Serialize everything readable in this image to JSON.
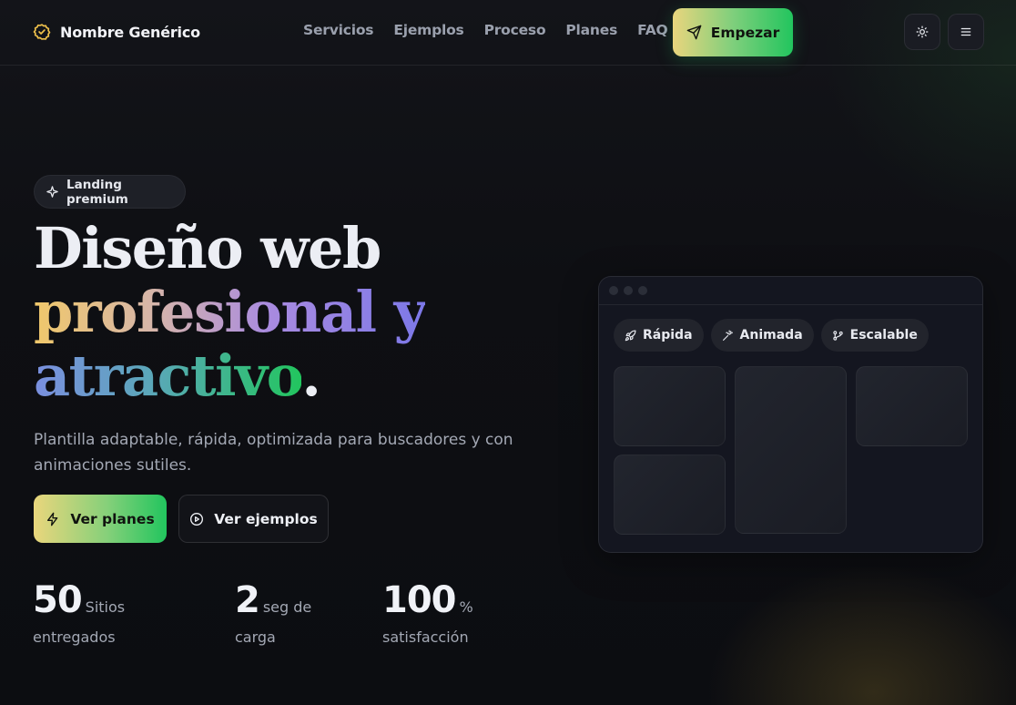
{
  "header": {
    "brand_name": "Nombre Genérico",
    "brand_icon": "badge-check-icon",
    "nav": [
      "Servicios",
      "Ejemplos",
      "Proceso",
      "Planes",
      "FAQ"
    ],
    "cta_label": "Empezar",
    "cta_icon": "send-icon",
    "theme_icon": "sun-icon",
    "menu_icon": "menu-icon"
  },
  "hero": {
    "badge_label": "Landing premium",
    "badge_icon": "sparkle-icon",
    "headline_line1": "Diseño web",
    "headline_grad1": "profesional y",
    "headline_grad2": "atractivo",
    "headline_dot": ".",
    "subtitle": "Plantilla adaptable, rápida, optimizada para buscadores y con animaciones sutiles.",
    "primary_label": "Ver planes",
    "primary_icon": "zap-icon",
    "secondary_label": "Ver ejemplos",
    "secondary_icon": "play-circle-icon"
  },
  "stats": [
    {
      "value": "50",
      "unit": "Sitios",
      "sub": "entregados"
    },
    {
      "value": "2",
      "unit": "seg de",
      "sub": "carga"
    },
    {
      "value": "100",
      "unit": "%",
      "sub": "satisfacción"
    }
  ],
  "preview": {
    "chips": [
      {
        "label": "Rápida",
        "icon": "rocket-icon"
      },
      {
        "label": "Animada",
        "icon": "wand-icon"
      },
      {
        "label": "Escalable",
        "icon": "git-branch-icon"
      }
    ]
  },
  "colors": {
    "accent_start": "#e9d57d",
    "accent_end": "#22c55e",
    "background": "#0d0e12"
  }
}
